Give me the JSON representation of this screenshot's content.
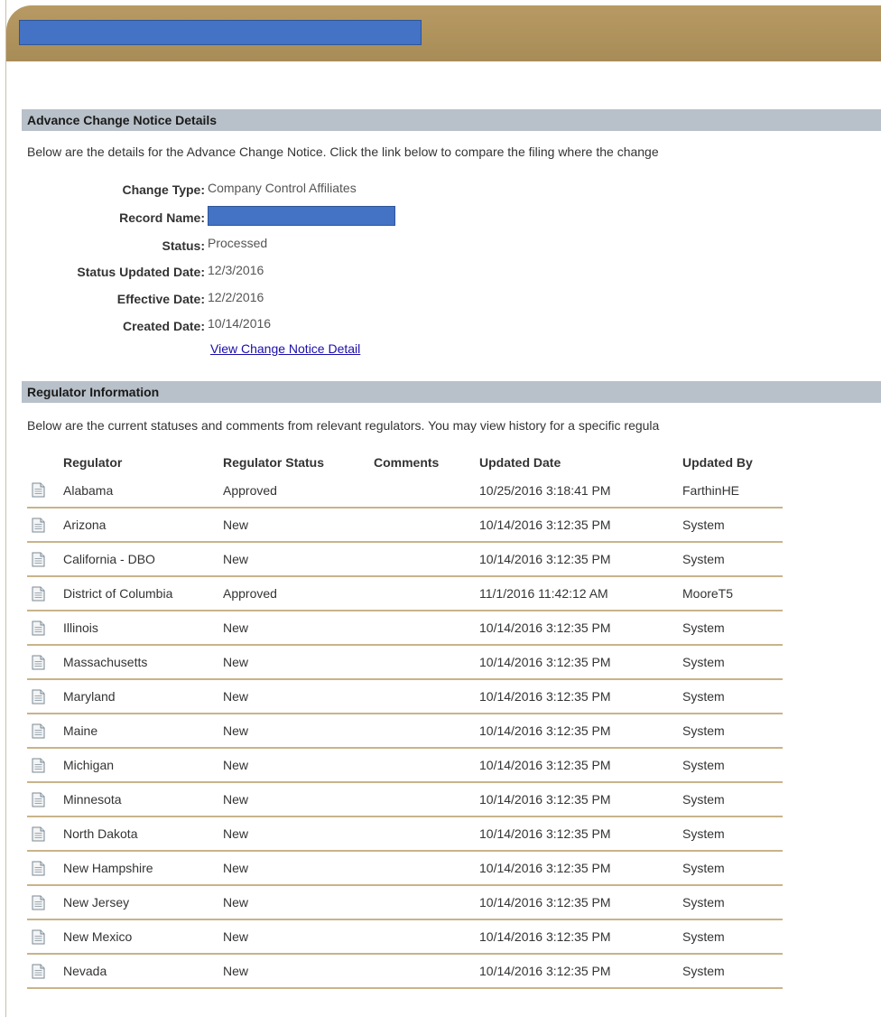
{
  "colors": {
    "banner": "#b09357",
    "section_header": "#b8c0c9",
    "row_divider": "#c9b38a",
    "link": "#1a0dab",
    "redaction": "#4472c4"
  },
  "details_section": {
    "title": "Advance Change Notice Details",
    "intro": "Below are the details for the Advance Change Notice. Click the link below to compare the filing where the change",
    "change_type_label": "Change Type:",
    "change_type_value": "Company Control Affiliates",
    "record_name_label": "Record Name:",
    "status_label": "Status:",
    "status_value": "Processed",
    "status_updated_label": "Status Updated Date:",
    "status_updated_value": "12/3/2016",
    "effective_date_label": "Effective Date:",
    "effective_date_value": "12/2/2016",
    "created_date_label": "Created Date:",
    "created_date_value": "10/14/2016",
    "link_text": "View Change Notice Detail"
  },
  "regulator_section": {
    "title": "Regulator Information",
    "intro": "Below are the current statuses and comments from relevant regulators. You may view history for a specific regula",
    "columns": [
      "Regulator",
      "Regulator Status",
      "Comments",
      "Updated Date",
      "Updated By"
    ],
    "rows": [
      {
        "regulator": "Alabama",
        "status": "Approved",
        "comments": "",
        "updated_date": "10/25/2016 3:18:41 PM",
        "updated_by": "FarthinHE"
      },
      {
        "regulator": "Arizona",
        "status": "New",
        "comments": "",
        "updated_date": "10/14/2016 3:12:35 PM",
        "updated_by": "System"
      },
      {
        "regulator": "California - DBO",
        "status": "New",
        "comments": "",
        "updated_date": "10/14/2016 3:12:35 PM",
        "updated_by": "System"
      },
      {
        "regulator": "District of Columbia",
        "status": "Approved",
        "comments": "",
        "updated_date": "11/1/2016 11:42:12 AM",
        "updated_by": "MooreT5"
      },
      {
        "regulator": "Illinois",
        "status": "New",
        "comments": "",
        "updated_date": "10/14/2016 3:12:35 PM",
        "updated_by": "System"
      },
      {
        "regulator": "Massachusetts",
        "status": "New",
        "comments": "",
        "updated_date": "10/14/2016 3:12:35 PM",
        "updated_by": "System"
      },
      {
        "regulator": "Maryland",
        "status": "New",
        "comments": "",
        "updated_date": "10/14/2016 3:12:35 PM",
        "updated_by": "System"
      },
      {
        "regulator": "Maine",
        "status": "New",
        "comments": "",
        "updated_date": "10/14/2016 3:12:35 PM",
        "updated_by": "System"
      },
      {
        "regulator": "Michigan",
        "status": "New",
        "comments": "",
        "updated_date": "10/14/2016 3:12:35 PM",
        "updated_by": "System"
      },
      {
        "regulator": "Minnesota",
        "status": "New",
        "comments": "",
        "updated_date": "10/14/2016 3:12:35 PM",
        "updated_by": "System"
      },
      {
        "regulator": "North Dakota",
        "status": "New",
        "comments": "",
        "updated_date": "10/14/2016 3:12:35 PM",
        "updated_by": "System"
      },
      {
        "regulator": "New Hampshire",
        "status": "New",
        "comments": "",
        "updated_date": "10/14/2016 3:12:35 PM",
        "updated_by": "System"
      },
      {
        "regulator": "New Jersey",
        "status": "New",
        "comments": "",
        "updated_date": "10/14/2016 3:12:35 PM",
        "updated_by": "System"
      },
      {
        "regulator": "New Mexico",
        "status": "New",
        "comments": "",
        "updated_date": "10/14/2016 3:12:35 PM",
        "updated_by": "System"
      },
      {
        "regulator": "Nevada",
        "status": "New",
        "comments": "",
        "updated_date": "10/14/2016 3:12:35 PM",
        "updated_by": "System"
      }
    ]
  }
}
